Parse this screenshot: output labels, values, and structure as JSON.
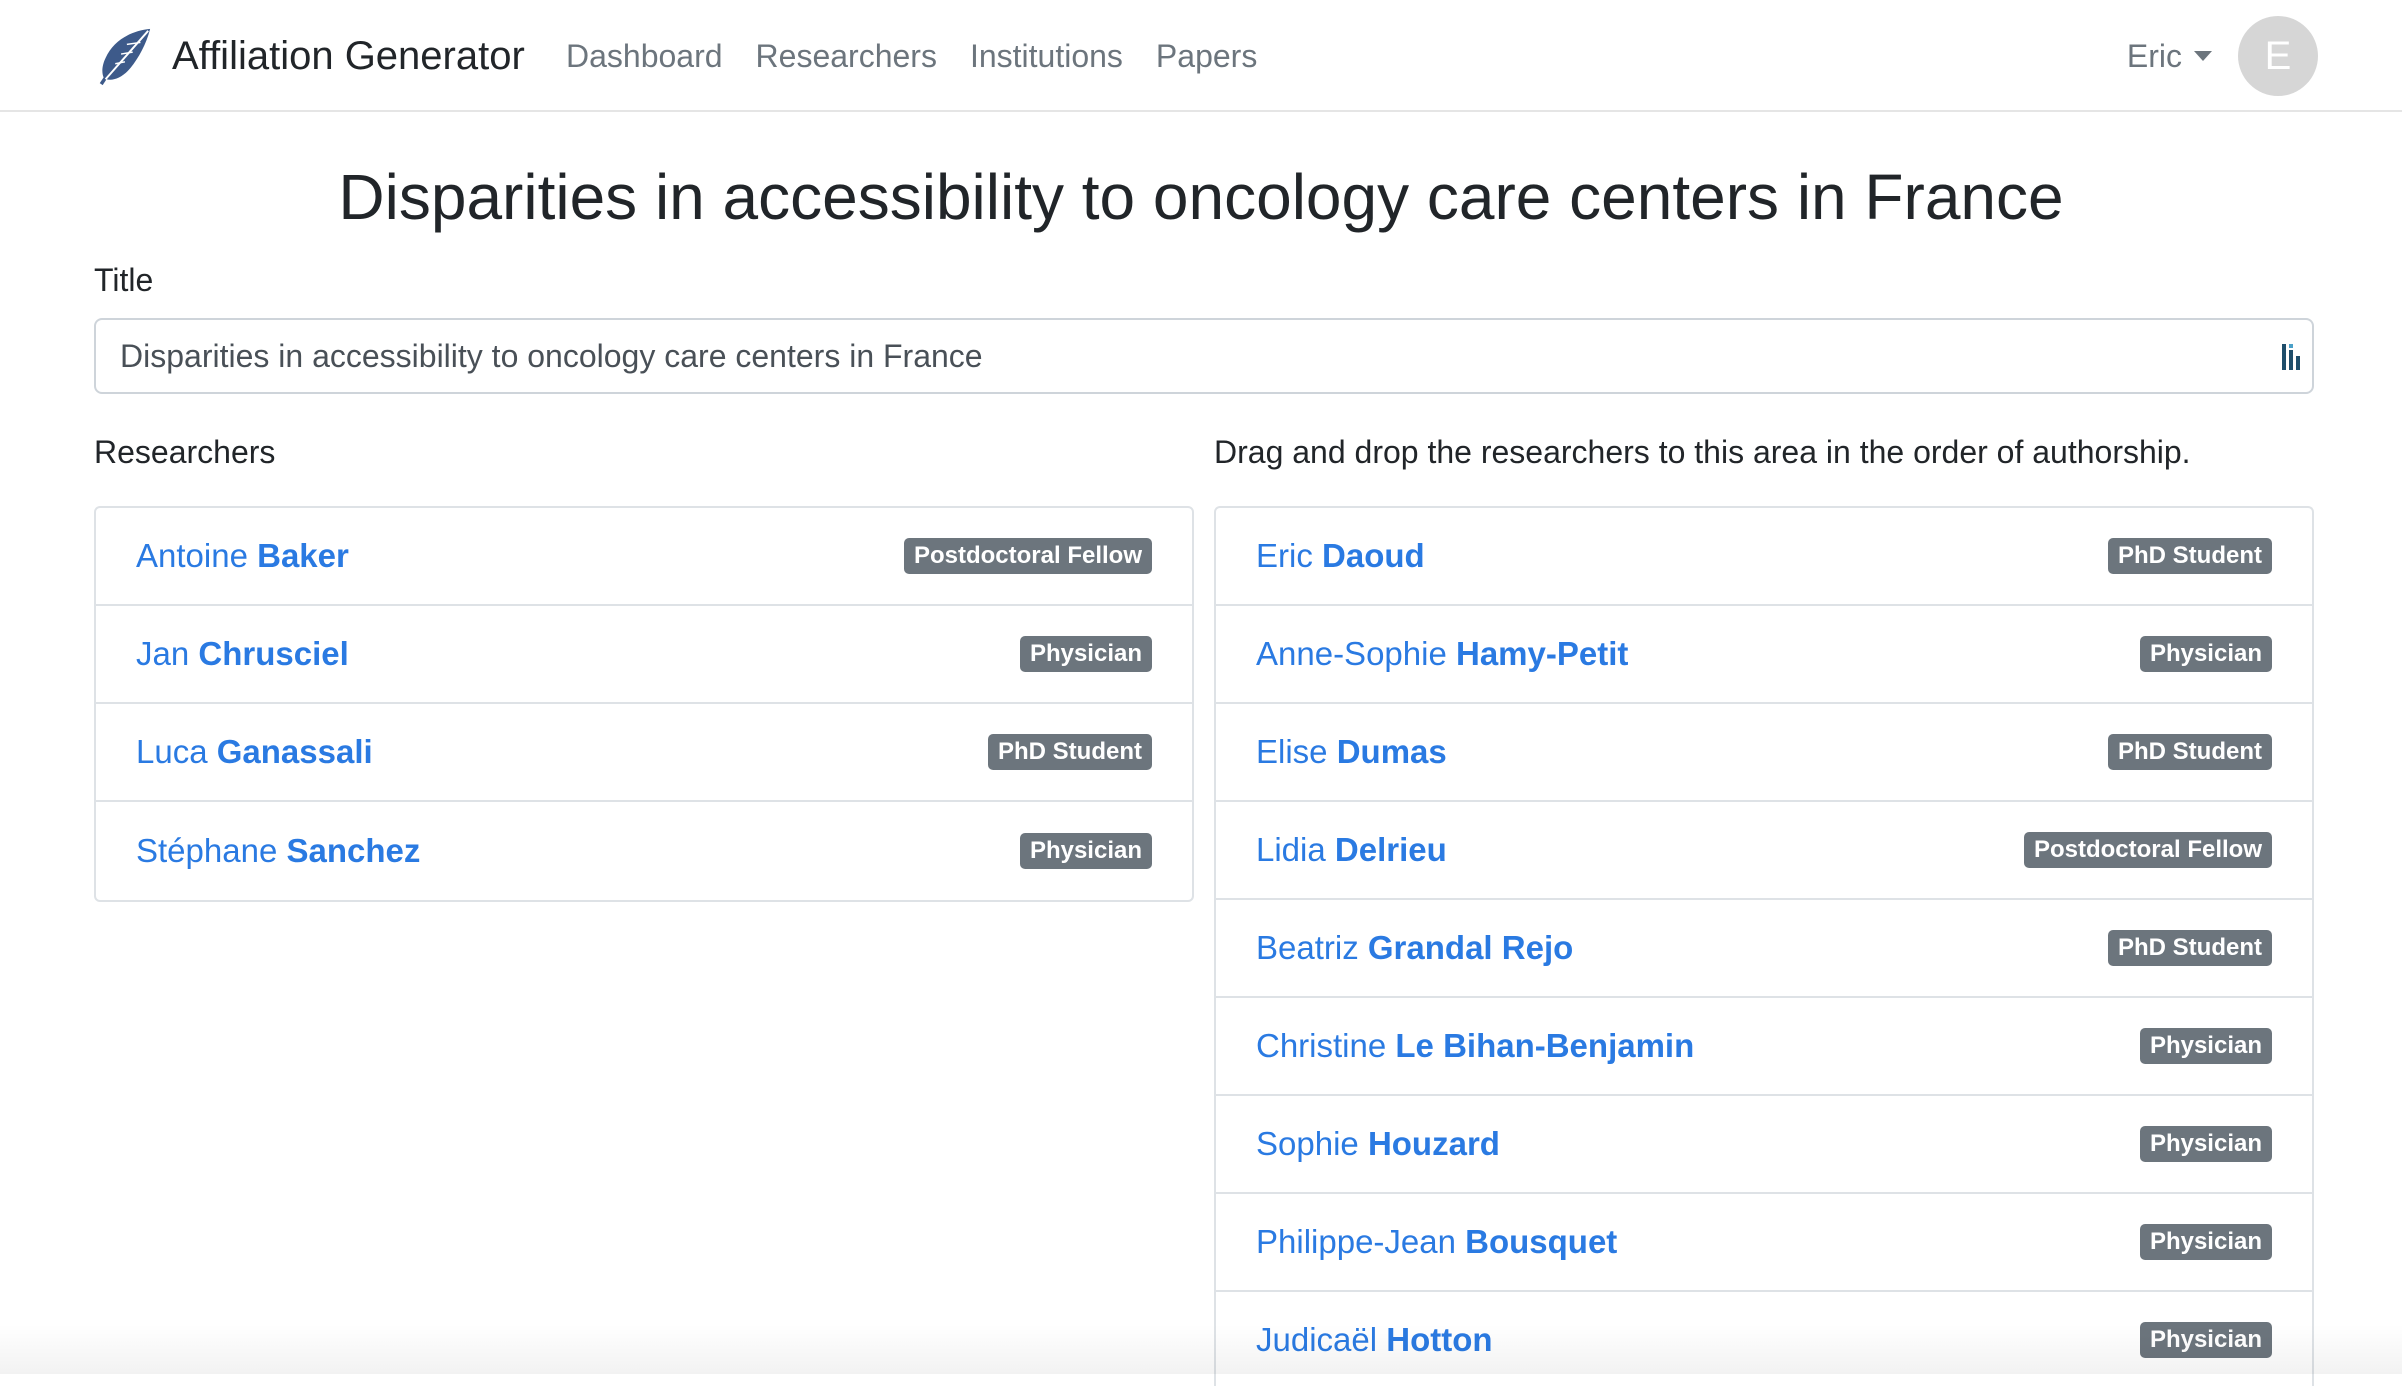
{
  "navbar": {
    "brand": "Affiliation Generator",
    "links": [
      "Dashboard",
      "Researchers",
      "Institutions",
      "Papers"
    ],
    "user_name": "Eric",
    "avatar_letter": "E"
  },
  "page": {
    "heading": "Disparities in accessibility to oncology care centers in France",
    "title_label": "Title",
    "title_value": "Disparities in accessibility to oncology care centers in France",
    "researchers_label": "Researchers",
    "drop_label": "Drag and drop the researchers to this area in the order of authorship."
  },
  "researchers_available": [
    {
      "first": "Antoine",
      "last": "Baker",
      "role": "Postdoctoral Fellow"
    },
    {
      "first": "Jan",
      "last": "Chrusciel",
      "role": "Physician"
    },
    {
      "first": "Luca",
      "last": "Ganassali",
      "role": "PhD Student"
    },
    {
      "first": "Stéphane",
      "last": "Sanchez",
      "role": "Physician"
    }
  ],
  "authors_ordered": [
    {
      "first": "Eric",
      "last": "Daoud",
      "role": "PhD Student"
    },
    {
      "first": "Anne-Sophie",
      "last": "Hamy-Petit",
      "role": "Physician"
    },
    {
      "first": "Elise",
      "last": "Dumas",
      "role": "PhD Student"
    },
    {
      "first": "Lidia",
      "last": "Delrieu",
      "role": "Postdoctoral Fellow"
    },
    {
      "first": "Beatriz",
      "last": "Grandal Rejo",
      "role": "PhD Student"
    },
    {
      "first": "Christine",
      "last": "Le Bihan-Benjamin",
      "role": "Physician"
    },
    {
      "first": "Sophie",
      "last": "Houzard",
      "role": "Physician"
    },
    {
      "first": "Philippe-Jean",
      "last": "Bousquet",
      "role": "Physician"
    },
    {
      "first": "Judicaël",
      "last": "Hotton",
      "role": "Physician"
    }
  ],
  "colors": {
    "link": "#2a7ae2",
    "badge": "#6c757d",
    "brand_logo": "#3d5a8a"
  },
  "icons": {
    "brand": "feather-icon",
    "input": "password-manager-icon",
    "user_menu": "caret-down-icon"
  }
}
